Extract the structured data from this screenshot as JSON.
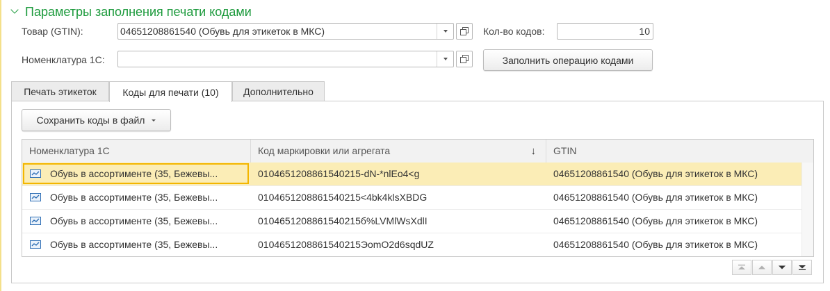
{
  "group": {
    "title": "Параметры заполнения печати кодами"
  },
  "form": {
    "product_label": "Товар (GTIN):",
    "product_value": "04651208861540 (Обувь для этикеток в МКС)",
    "count_label": "Кол-во кодов:",
    "count_value": "10",
    "nomenclature_label": "Номенклатура 1С:",
    "nomenclature_value": "",
    "fill_button": "Заполнить операцию кодами"
  },
  "tabs": [
    {
      "label": "Печать этикеток",
      "active": false
    },
    {
      "label": "Коды для печати (10)",
      "active": true
    },
    {
      "label": "Дополнительно",
      "active": false
    }
  ],
  "panel": {
    "save_button": "Сохранить коды в файл"
  },
  "table": {
    "columns": [
      "Номенклатура 1С",
      "Код маркировки или агрегата",
      "GTIN"
    ],
    "sort_indicator": "↓",
    "rows": [
      {
        "nomenclature": "Обувь в ассортименте (35, Бежевы...",
        "code": "0104651208861540215-dN-*nlEo4<g",
        "gtin": "04651208861540 (Обувь для этикеток в МКС)",
        "selected": true
      },
      {
        "nomenclature": "Обувь в ассортименте (35, Бежевы...",
        "code": "0104651208861540215<4bk4klsXBDG",
        "gtin": "04651208861540 (Обувь для этикеток в МКС)",
        "selected": false
      },
      {
        "nomenclature": "Обувь в ассортименте (35, Бежевы...",
        "code": "0104651208861540215б%LVMlWsXdlI",
        "gtin": "04651208861540 (Обувь для этикеток в МКС)",
        "selected": false
      },
      {
        "nomenclature": "Обувь в ассортименте (35, Бежевы...",
        "code": "0104651208861540215ЭomO2d6sqdUZ",
        "gtin": "04651208861540 (Обувь для этикеток в МКС)",
        "selected": false
      }
    ]
  },
  "colors": {
    "group_title": "#1c9a3c",
    "selected_row": "#fbedb6",
    "focus_border": "#f3b600",
    "row_icon": "#2f6fb5"
  }
}
